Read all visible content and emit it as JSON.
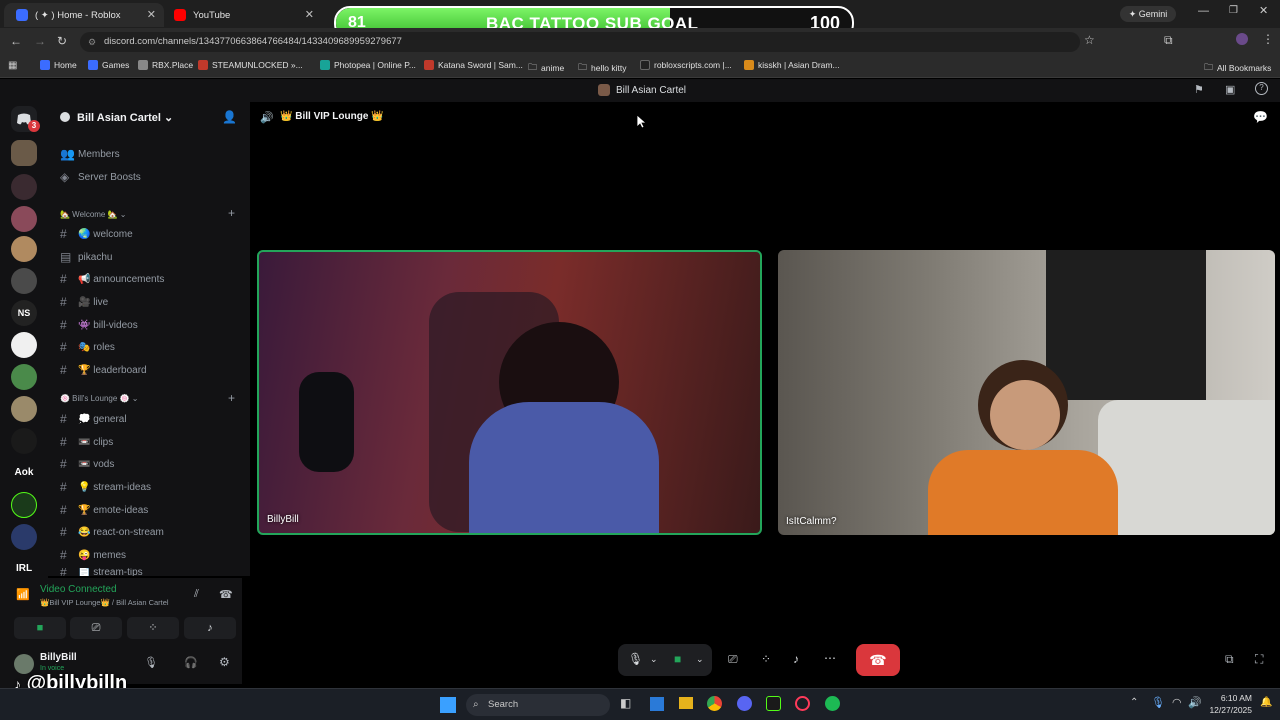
{
  "browser": {
    "tabs": [
      {
        "label": "( ✦ ) Home - Roblox",
        "color": "#3b6cff"
      },
      {
        "label": "YouTube",
        "color": "#ff0000"
      }
    ],
    "url": "discord.com/channels/1343770663864766484/1433409689959279677",
    "bookmarks": [
      "Home",
      "Games",
      "RBX.Place",
      "STEAMUNLOCKED »...",
      "Photopea | Online P...",
      "Katana Sword | Sam...",
      "anime",
      "hello kitty",
      "robloxscripts.com |...",
      "kisskh | Asian Dram...",
      "All Bookmarks"
    ],
    "gemini_label": "Gemini"
  },
  "goal": {
    "current": "81",
    "title": "BAC TATTOO SUB GOAL",
    "target": "100",
    "progress": 0.81,
    "accent": "#4fd43c"
  },
  "discord": {
    "window_title": "Bill Asian Cartel",
    "server_name": "Bill Asian Cartel",
    "guild_badge": "3",
    "guild_text": [
      "NS",
      "Aok",
      "IRL"
    ],
    "top_items": [
      "Members",
      "Server Boosts"
    ],
    "categories": [
      {
        "name": "🏡 Welcome 🏡",
        "channels": [
          "🌏 welcome",
          "pikachu",
          "📢 announcements",
          "🎥 live",
          "👾 bill-videos",
          "🎭 roles",
          "🏆 leaderboard"
        ]
      },
      {
        "name": "🍥 Bill's Lounge 🍥",
        "channels": [
          "💭 general",
          "📼 clips",
          "📼 vods",
          "💡 stream-ideas",
          "🏆 emote-ideas",
          "😂 react-on-stream",
          "😜 memes",
          "📄 stream-tips"
        ]
      }
    ],
    "voice": {
      "status": "Video Connected",
      "location": "👑Bill VIP Lounge👑 / Bill Asian Cartel",
      "status_color": "#23a55a"
    },
    "user": {
      "name": "BillyBill",
      "status": "In voice"
    },
    "channel_header": "👑 Bill VIP Lounge 👑",
    "participants": [
      {
        "name": "BillyBill"
      },
      {
        "name": "IsItCalmm?"
      }
    ],
    "hangup_color": "#da373c"
  },
  "watermark": "@billybilln",
  "taskbar": {
    "search": "Search",
    "time": "6:10 AM",
    "date": "12/27/2025"
  }
}
